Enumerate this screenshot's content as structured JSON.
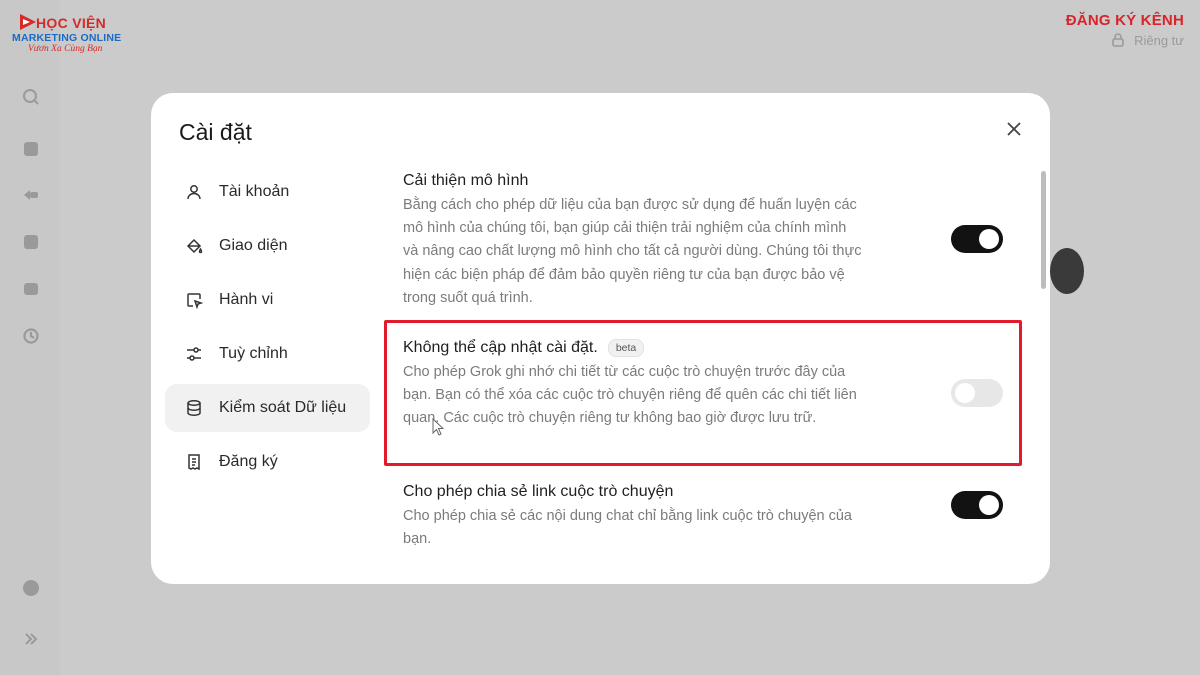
{
  "brand": {
    "line1": "HỌC VIỆN",
    "line2": "MARKETING ONLINE",
    "line3": "Vươn Xa Cùng Bạn"
  },
  "topbar": {
    "subscribe_label": "ĐĂNG KÝ KÊNH",
    "private_label": "Riêng tư"
  },
  "modal": {
    "title": "Cài đặt",
    "nav": [
      {
        "label": "Tài khoản",
        "icon": "user-icon",
        "active": false
      },
      {
        "label": "Giao diện",
        "icon": "paint-bucket-icon",
        "active": false
      },
      {
        "label": "Hành vi",
        "icon": "cursor-box-icon",
        "active": false
      },
      {
        "label": "Tuỳ chỉnh",
        "icon": "sliders-icon",
        "active": false
      },
      {
        "label": "Kiểm soát Dữ liệu",
        "icon": "database-icon",
        "active": true
      },
      {
        "label": "Đăng ký",
        "icon": "receipt-icon",
        "active": false
      }
    ],
    "settings": [
      {
        "title": "Cải thiện mô hình",
        "badge": "",
        "description": "Bằng cách cho phép dữ liệu của bạn được sử dụng để huấn luyện các mô hình của chúng tôi, bạn giúp cải thiện trải nghiệm của chính mình và nâng cao chất lượng mô hình cho tất cả người dùng. Chúng tôi thực hiện các biện pháp để đảm bảo quyền riêng tư của bạn được bảo vệ trong suốt quá trình.",
        "enabled": true
      },
      {
        "title": "Không thể cập nhật cài đặt.",
        "badge": "beta",
        "description": "Cho phép Grok ghi nhớ chi tiết từ các cuộc trò chuyện trước đây của bạn. Bạn có thể xóa các cuộc trò chuyện riêng để quên các chi tiết liên quan. Các cuộc trò chuyện riêng tư không bao giờ được lưu trữ.",
        "enabled": false
      },
      {
        "title": "Cho phép chia sẻ link cuộc trò chuyện",
        "badge": "",
        "description": "Cho phép chia sẻ các nội dung chat chỉ bằng link cuộc trò chuyện của bạn.",
        "enabled": true
      }
    ]
  },
  "colors": {
    "highlight": "#e01b2b",
    "toggle_on": "#121212",
    "toggle_off": "#e7e7e7",
    "brand_red": "#d42a2a",
    "brand_blue": "#1a6bc9"
  }
}
